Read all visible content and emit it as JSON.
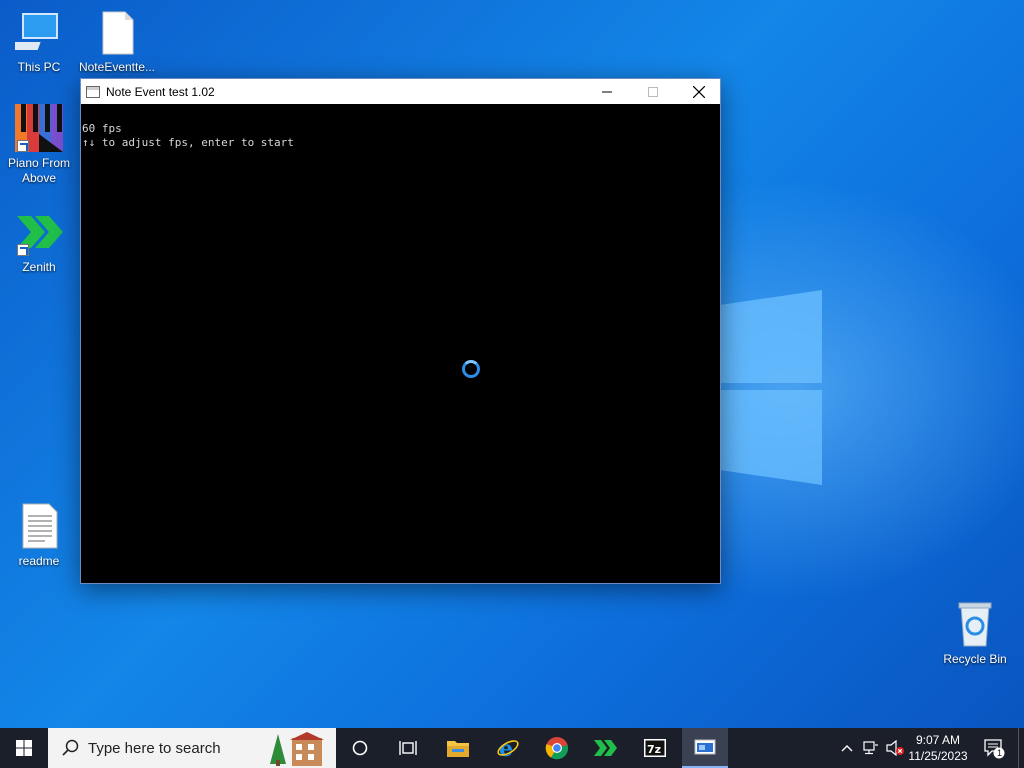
{
  "desktop": {
    "icons": [
      {
        "label": "This PC"
      },
      {
        "label": "NoteEventte..."
      },
      {
        "label": "Piano From Above"
      },
      {
        "label": "Zenith"
      },
      {
        "label": "readme"
      },
      {
        "label": "Recycle Bin"
      }
    ]
  },
  "window": {
    "title": "Note Event test 1.02",
    "console_lines": [
      "60 fps",
      "↑↓ to adjust fps, enter to start"
    ]
  },
  "taskbar": {
    "search_placeholder": "Type here to search",
    "time": "9:07 AM",
    "date": "11/25/2023",
    "notification_count": "1",
    "apps": [
      "Task View",
      "File Explorer",
      "Internet Explorer",
      "Google Chrome",
      "Zenith",
      "7-Zip",
      "Note Event test 1.02"
    ]
  },
  "colors": {
    "wallpaper": "#0a6fd8",
    "taskbar": "#1b1f2a",
    "spinner": "#2a8ee8"
  }
}
